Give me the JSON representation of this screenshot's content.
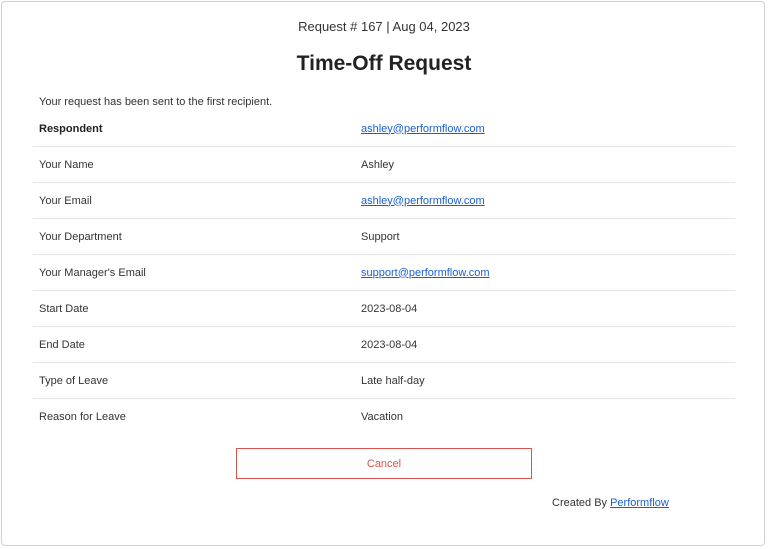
{
  "header": {
    "request_meta": "Request # 167 | Aug 04, 2023",
    "title": "Time-Off Request"
  },
  "notice": "Your request has been sent to the first recipient.",
  "details": {
    "respondent_label": "Respondent",
    "respondent_value": "ashley@performflow.com",
    "rows": [
      {
        "label": "Your Name",
        "value": "Ashley"
      },
      {
        "label": "Your Email",
        "value": "ashley@performflow.com"
      },
      {
        "label": "Your Department",
        "value": "Support"
      },
      {
        "label": "Your Manager's Email",
        "value": "support@performflow.com"
      },
      {
        "label": "Start Date",
        "value": "2023-08-04"
      },
      {
        "label": "End Date",
        "value": "2023-08-04"
      },
      {
        "label": "Type of Leave",
        "value": "Late half-day"
      },
      {
        "label": "Reason for Leave",
        "value": "Vacation"
      }
    ]
  },
  "actions": {
    "cancel_label": "Cancel"
  },
  "footer": {
    "prefix": "Created By ",
    "brand": "Performflow"
  },
  "colors": {
    "link": "#1a5fd1",
    "cancel": "#d9534f",
    "divider": "#e4e4e4"
  }
}
